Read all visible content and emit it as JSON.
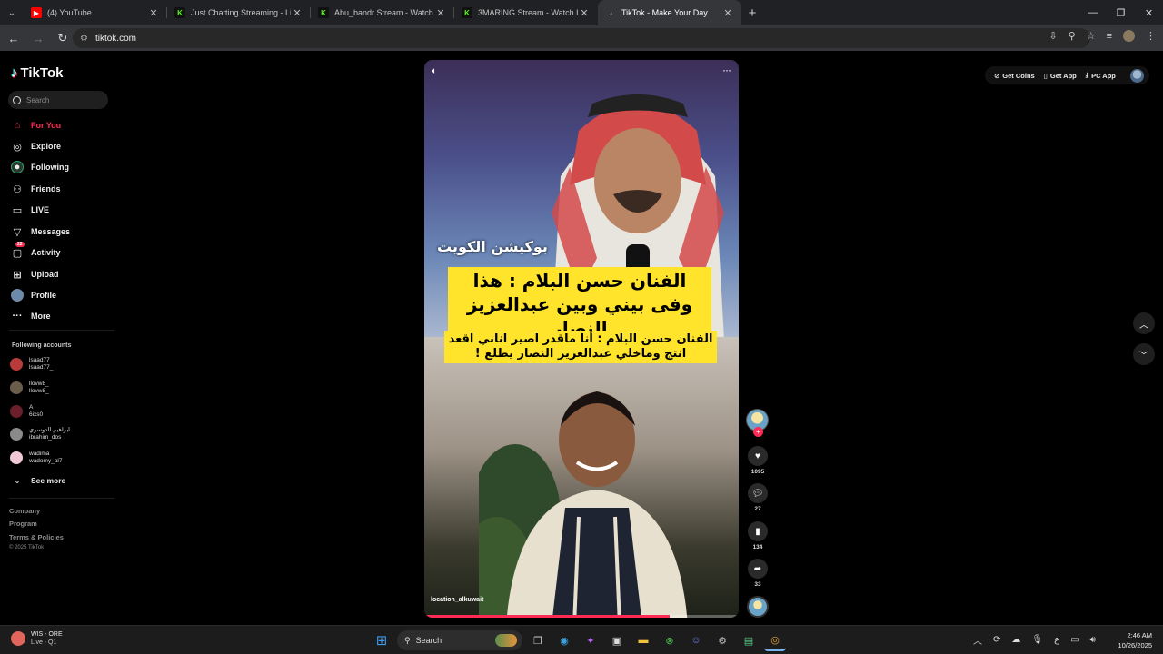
{
  "browser": {
    "tabs": [
      {
        "title": "(4) YouTube",
        "favicon": "youtube-icon",
        "color": "#ff0000"
      },
      {
        "title": "Just Chatting Streaming - Live",
        "favicon": "kick-icon",
        "color": "#53fc18"
      },
      {
        "title": "Abu_bandr Stream - Watch Live",
        "favicon": "kick-icon",
        "color": "#53fc18"
      },
      {
        "title": "3MARING Stream - Watch Live",
        "favicon": "kick-icon",
        "color": "#53fc18"
      },
      {
        "title": "TikTok - Make Your Day",
        "favicon": "tiktok-icon",
        "color": "#ffffff",
        "active": true
      }
    ],
    "url": "tiktok.com"
  },
  "tiktok": {
    "logo_text": "TikTok",
    "search_placeholder": "Search",
    "nav": [
      {
        "label": "For You",
        "icon": "home-icon",
        "active": true
      },
      {
        "label": "Explore",
        "icon": "compass-icon"
      },
      {
        "label": "Following",
        "icon": "following-icon"
      },
      {
        "label": "Friends",
        "icon": "friends-icon"
      },
      {
        "label": "LIVE",
        "icon": "live-icon"
      },
      {
        "label": "Messages",
        "icon": "messages-icon"
      },
      {
        "label": "Activity",
        "icon": "activity-icon",
        "badge": "22"
      },
      {
        "label": "Upload",
        "icon": "upload-icon"
      },
      {
        "label": "Profile",
        "icon": "profile-icon"
      },
      {
        "label": "More",
        "icon": "more-icon"
      }
    ],
    "following_title": "Following accounts",
    "accounts": [
      {
        "display": "lsaad77",
        "handle": "lsaad77_",
        "color": "#b83a3a"
      },
      {
        "display": "llovw8_",
        "handle": "llovw8_",
        "color": "#6b5d4c"
      },
      {
        "display": "A",
        "handle": "6ixs0",
        "color": "#6a1f2a"
      },
      {
        "display": "ابراهيم الدوسري",
        "handle": "ibrahim_dos",
        "color": "#8a8a8a"
      },
      {
        "display": "wadima",
        "handle": "wadomy_al7",
        "color": "#f0c8d8"
      }
    ],
    "see_more": "See more",
    "footer": [
      "Company",
      "Program",
      "Terms & Policies"
    ],
    "copyright": "© 2025 TikTok",
    "top_buttons": [
      "Get Coins",
      "Get App",
      "PC App"
    ]
  },
  "video": {
    "watermark": "بوكيشن الكويت",
    "caption_main": "الفنان حسن البلام : هذا وفى بيني وبين عبدالعزيز النصار",
    "caption_sub": "الفنان حسن البلام : أنا ماقدر اصير اناني اقعد انتج وماخلي عبدالعزيز النصار يطلع !",
    "username": "location_alkuwait",
    "progress": 0.78,
    "likes": "1095",
    "comments": "27",
    "saves": "134",
    "shares": "33"
  },
  "taskbar": {
    "weather_title": "WIS - ORE",
    "weather_sub": "Live - Q1",
    "search_label": "Search",
    "time": "2:46 AM",
    "date": "10/26/2025",
    "lang": "ع"
  }
}
